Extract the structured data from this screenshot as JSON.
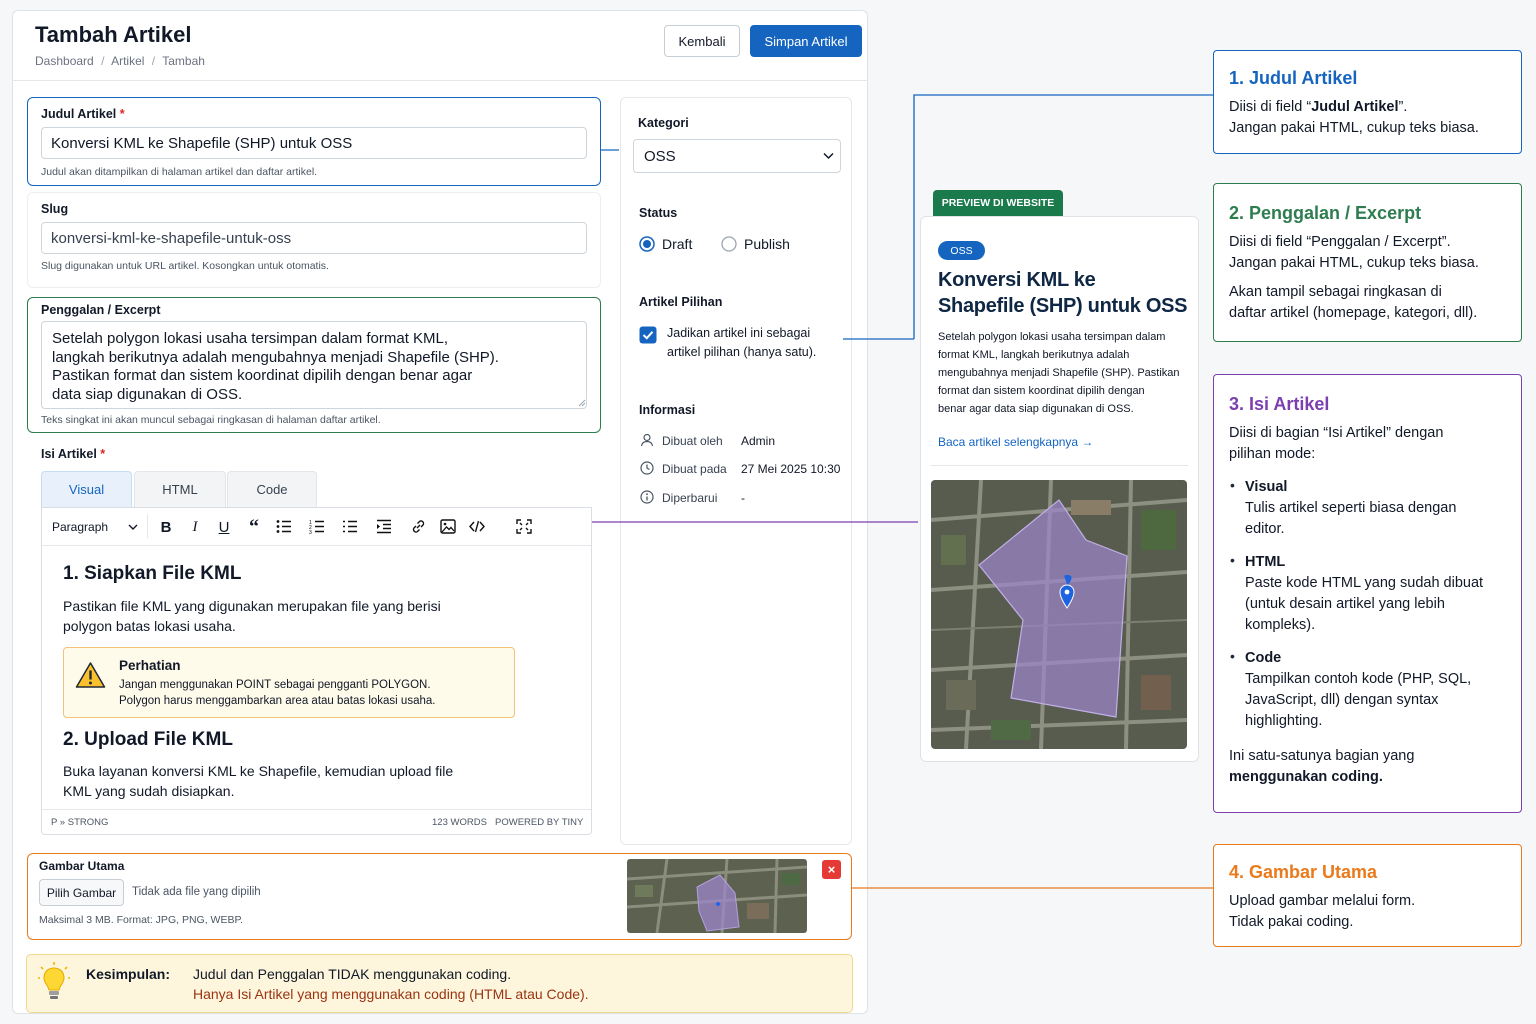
{
  "header": {
    "title": "Tambah Artikel",
    "breadcrumb": [
      "Dashboard",
      "Artikel",
      "Tambah"
    ],
    "back_label": "Kembali",
    "save_label": "Simpan Artikel"
  },
  "form": {
    "judul": {
      "label": "Judul Artikel",
      "required": "*",
      "value": "Konversi KML ke Shapefile (SHP) untuk OSS",
      "help": "Judul akan ditampilkan di halaman artikel dan daftar artikel."
    },
    "slug": {
      "label": "Slug",
      "value": "konversi-kml-ke-shapefile-untuk-oss",
      "help": "Slug digunakan untuk URL artikel. Kosongkan untuk otomatis."
    },
    "excerpt": {
      "label": "Penggalan / Excerpt",
      "lines": [
        "Setelah polygon lokasi usaha tersimpan dalam format KML,",
        "langkah berikutnya adalah mengubahnya menjadi Shapefile (SHP).",
        "Pastikan format dan sistem koordinat dipilih dengan benar agar",
        "data siap digunakan di OSS."
      ],
      "help": "Teks singkat ini akan muncul sebagai ringkasan di halaman daftar artikel."
    },
    "isi": {
      "label": "Isi Artikel",
      "required": "*",
      "tabs": [
        "Visual",
        "HTML",
        "Code"
      ],
      "block_format": "Paragraph",
      "h1": "1.  Siapkan File KML",
      "p1": [
        "Pastikan file KML yang digunakan merupakan file yang berisi",
        "polygon batas lokasi usaha."
      ],
      "warning": {
        "title": "Perhatian",
        "lines": [
          "Jangan menggunakan POINT sebagai pengganti POLYGON.",
          "Polygon harus menggambarkan area atau batas lokasi usaha."
        ]
      },
      "h2": "2.  Upload File KML",
      "p2": [
        "Buka layanan konversi KML ke Shapefile, kemudian upload file",
        "KML yang sudah disiapkan."
      ],
      "status_path": "P  »  STRONG",
      "word_count": "123 WORDS",
      "powered": "POWERED BY TINY"
    },
    "gambar": {
      "label": "Gambar Utama",
      "button": "Pilih Gambar",
      "no_file": "Tidak ada file yang dipilih",
      "help": "Maksimal 3 MB. Format: JPG, PNG, WEBP."
    }
  },
  "sidebar": {
    "kategori_label": "Kategori",
    "kategori_value": "OSS",
    "status_label": "Status",
    "status_options": [
      "Draft",
      "Publish"
    ],
    "status_selected": "Draft",
    "pilihan_label": "Artikel Pilihan",
    "pilihan_lines": [
      "Jadikan artikel ini sebagai",
      "artikel pilihan (hanya satu)."
    ],
    "info_label": "Informasi",
    "info": [
      {
        "key": "Dibuat oleh",
        "value": "Admin"
      },
      {
        "key": "Dibuat pada",
        "value": "27 Mei 2025 10:30"
      },
      {
        "key": "Diperbarui",
        "value": "-"
      }
    ]
  },
  "preview": {
    "tag": "PREVIEW DI WEBSITE",
    "badge": "OSS",
    "title_lines": [
      "Konversi KML ke",
      "Shapefile (SHP) untuk OSS"
    ],
    "excerpt_lines": [
      "Setelah polygon lokasi usaha tersimpan dalam",
      "format KML, langkah berikutnya adalah",
      "mengubahnya menjadi Shapefile (SHP). Pastikan",
      "format dan sistem koordinat dipilih dengan",
      "benar agar data siap digunakan di OSS."
    ],
    "link": "Baca artikel selengkapnya →"
  },
  "conclusion": {
    "label": "Kesimpulan:",
    "line1": "Judul dan Penggalan TIDAK menggunakan coding.",
    "line2": "Hanya Isi Artikel yang menggunakan coding (HTML atau Code)."
  },
  "notes": [
    {
      "title": "1. Judul Artikel",
      "color": "#1565c0",
      "l1_pre": "Diisi di field “",
      "l1_bold": "Judul Artikel",
      "l1_post": "”.",
      "l2": "Jangan pakai HTML, cukup teks biasa."
    },
    {
      "title": "2. Penggalan / Excerpt",
      "color": "#2e7d4f",
      "l1": "Diisi di field “Penggalan / Excerpt”.",
      "l2": "Jangan pakai HTML, cukup teks biasa.",
      "l3": "Akan tampil sebagai ringkasan di",
      "l4": "daftar artikel (homepage, kategori, dll)."
    },
    {
      "title": "3. Isi Artikel",
      "color": "#7b3fb0",
      "intro": [
        "Diisi di bagian “Isi Artikel” dengan",
        "pilihan mode:"
      ],
      "modes": [
        {
          "name": "Visual",
          "lines": [
            "Tulis artikel seperti biasa dengan",
            "editor."
          ]
        },
        {
          "name": "HTML",
          "lines": [
            "Paste kode HTML yang sudah dibuat",
            "(untuk desain artikel yang lebih",
            "kompleks)."
          ]
        },
        {
          "name": "Code",
          "lines": [
            "Tampilkan contoh kode (PHP, SQL,",
            "JavaScript, dll) dengan syntax",
            "highlighting."
          ]
        }
      ],
      "outro": "Ini satu-satunya bagian yang",
      "outro_bold": "menggunakan coding."
    },
    {
      "title": "4. Gambar Utama",
      "color": "#ea7a1c",
      "l1": "Upload gambar melalui form.",
      "l2": "Tidak pakai coding."
    }
  ],
  "colors": {
    "primary": "#1565c0",
    "green": "#2e7d4f",
    "purple": "#7b3fb0",
    "orange": "#ea7a1c"
  }
}
